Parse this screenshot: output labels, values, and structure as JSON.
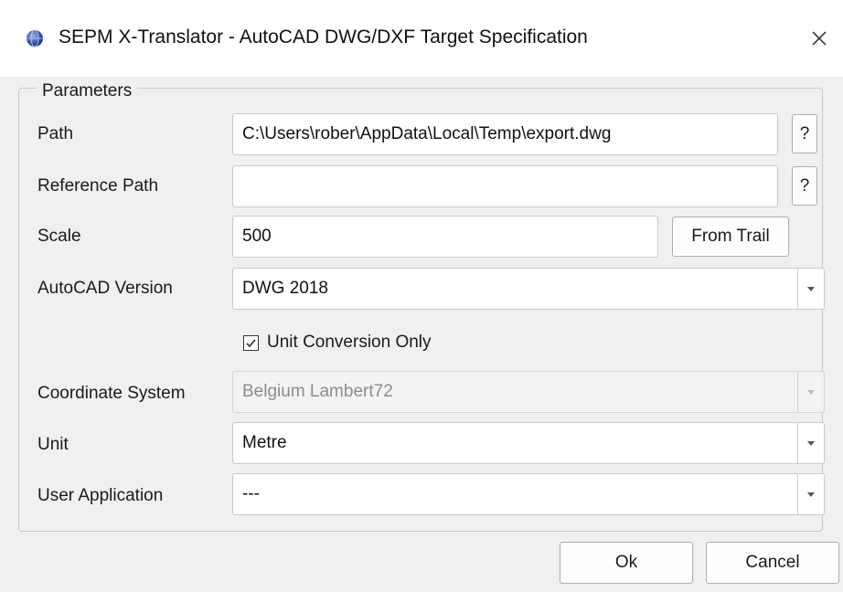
{
  "window": {
    "title": "SEPM X-Translator - AutoCAD DWG/DXF Target Specification",
    "icon": "globe-icon",
    "close_icon": "close-icon"
  },
  "parameters": {
    "legend": "Parameters",
    "path": {
      "label": "Path",
      "value": "C:\\Users\\rober\\AppData\\Local\\Temp\\export.dwg",
      "help_label": "?"
    },
    "reference_path": {
      "label": "Reference Path",
      "value": "",
      "help_label": "?"
    },
    "scale": {
      "label": "Scale",
      "value": "500",
      "button_label": "From Trail"
    },
    "autocad_version": {
      "label": "AutoCAD Version",
      "value": "DWG 2018"
    },
    "unit_conversion": {
      "label": "Unit Conversion Only",
      "checked": true
    },
    "coordinate_system": {
      "label": "Coordinate System",
      "value": "Belgium Lambert72",
      "disabled": true
    },
    "unit": {
      "label": "Unit",
      "value": "Metre"
    },
    "user_application": {
      "label": "User Application",
      "value": "---"
    }
  },
  "footer": {
    "ok_label": "Ok",
    "cancel_label": "Cancel"
  },
  "colors": {
    "background": "#f0f0f0",
    "titlebar": "#ffffff",
    "disabled_text": "#8c8c8c"
  }
}
